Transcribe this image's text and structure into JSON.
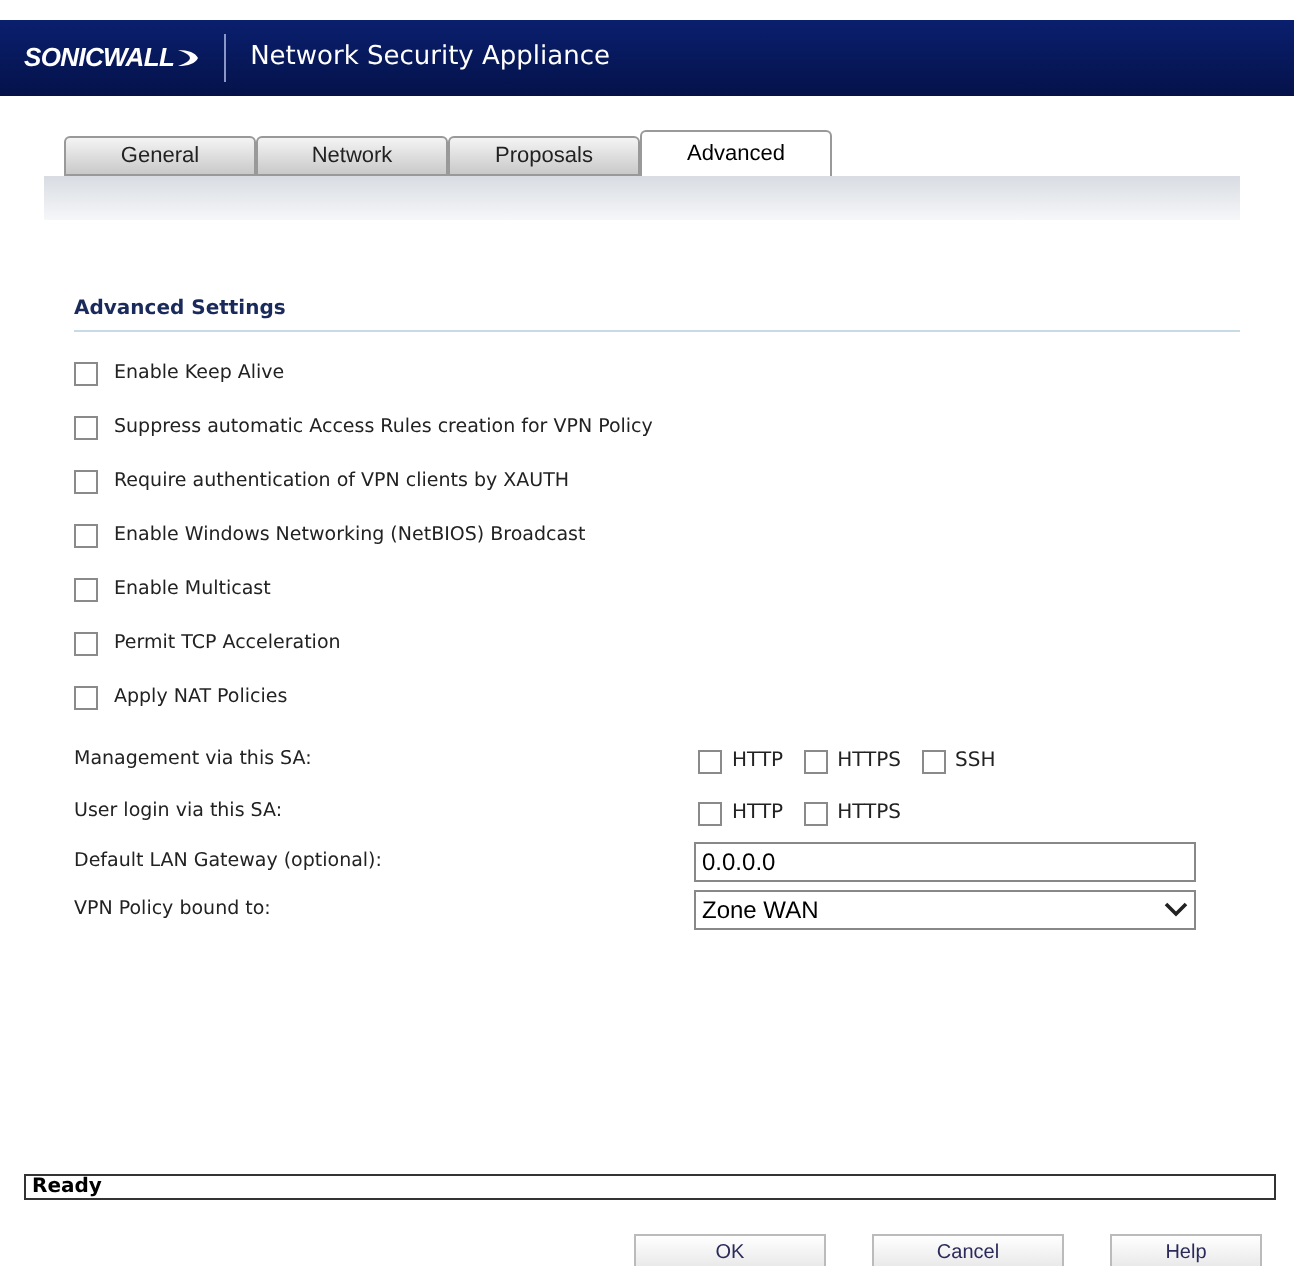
{
  "header": {
    "logo": "SONICWALL",
    "title": "Network Security Appliance"
  },
  "tabs": [
    {
      "label": "General",
      "selected": false
    },
    {
      "label": "Network",
      "selected": false
    },
    {
      "label": "Proposals",
      "selected": false
    },
    {
      "label": "Advanced",
      "selected": true
    }
  ],
  "section_title": "Advanced Settings",
  "options": [
    {
      "label": "Enable Keep Alive",
      "checked": false
    },
    {
      "label": "Suppress automatic Access Rules creation for VPN Policy",
      "checked": false
    },
    {
      "label": "Require authentication of VPN clients by XAUTH",
      "checked": false
    },
    {
      "label": "Enable Windows Networking (NetBIOS) Broadcast",
      "checked": false
    },
    {
      "label": "Enable Multicast",
      "checked": false
    },
    {
      "label": "Permit TCP Acceleration",
      "checked": false
    },
    {
      "label": "Apply NAT Policies",
      "checked": false
    }
  ],
  "fields": [
    {
      "kind": "checkboxes",
      "label": "Management via this SA:",
      "choices": [
        {
          "label": "HTTP",
          "checked": false
        },
        {
          "label": "HTTPS",
          "checked": false
        },
        {
          "label": "SSH",
          "checked": false
        }
      ]
    },
    {
      "kind": "checkboxes",
      "label": "User login via this SA:",
      "choices": [
        {
          "label": "HTTP",
          "checked": false
        },
        {
          "label": "HTTPS",
          "checked": false
        }
      ]
    },
    {
      "kind": "text",
      "label": "Default LAN Gateway (optional):",
      "value": "0.0.0.0"
    },
    {
      "kind": "select",
      "label": "VPN Policy bound to:",
      "value": "Zone WAN"
    }
  ],
  "status_bar": "Ready",
  "buttons": [
    "OK",
    "Cancel",
    "Help"
  ]
}
